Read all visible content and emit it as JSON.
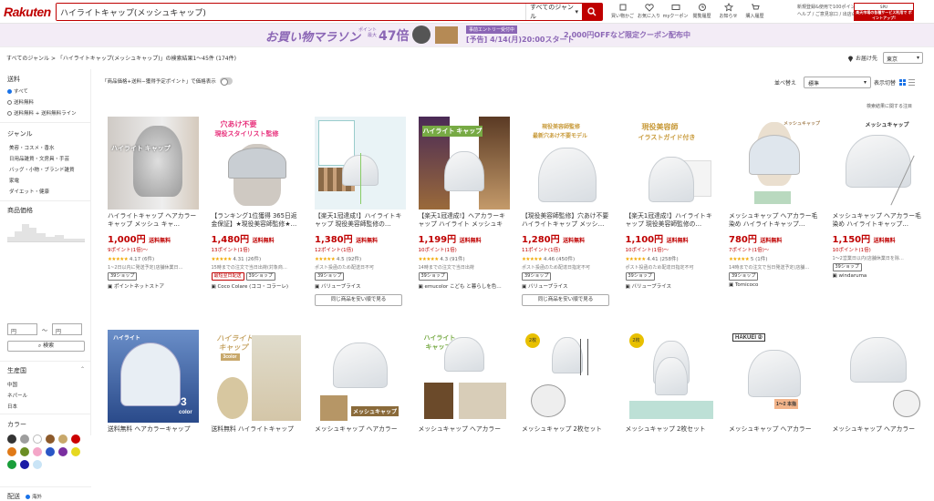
{
  "header": {
    "logo": "Rakuten",
    "search_value": "ハイライトキャップ(メッシュキャップ)",
    "genre": "すべてのジャンル",
    "icons": [
      {
        "name": "purchase-history-icon",
        "label": "買い物かご"
      },
      {
        "name": "favorite-icon",
        "label": "お気に入り"
      },
      {
        "name": "coupon-icon",
        "label": "myクーポン"
      },
      {
        "name": "history-icon",
        "label": "閲覧履歴"
      },
      {
        "name": "notify-icon",
        "label": "お知らせ"
      },
      {
        "name": "cart-icon",
        "label": "購入履歴"
      }
    ],
    "note_line1": "新規登録&使用で100ポイント!",
    "note_line2": "ヘルプ / ご意見窓口 / 出店のご案内",
    "ad_line1": "SPU",
    "ad_line2": "楽天市場の各種サービス利用で ポイントアップ!"
  },
  "banner": {
    "title": "お買い物マラソン",
    "sub1": "ポイント",
    "sub2": "最大",
    "times": "47倍",
    "entry": "事前エントリー受付中",
    "start": "[予告] 4/14(月)20:00スタート",
    "coupon": "2,000円OFFなど限定クーポン配布中"
  },
  "breadcrumb": "すべてのジャンル > 「ハイライトキャップ(メッシュキャップ)」の検索結果1〜45件 (174件)",
  "delivery": {
    "label": "お届け先",
    "value": "東京"
  },
  "sidebar": {
    "shipping_h": "送料",
    "shipping_opts": [
      "すべて",
      "送料無料",
      "送料無料 + 送料無料ライン"
    ],
    "genre_h": "ジャンル",
    "genres": [
      "美容・コスメ・香水",
      "日用品雑貨・文房具・手芸",
      "バッグ・小物・ブランド雑貨",
      "家電",
      "ダイエット・健康"
    ],
    "price_h": "商品価格",
    "price_min": "円",
    "price_tilde": "〜",
    "price_max": "円",
    "search_btn": "検索",
    "origin_h": "生産国",
    "origins": [
      "中国",
      "ネパール",
      "日本"
    ],
    "color_h": "カラー",
    "delivery_h": "配送",
    "delivery_opt": "海外"
  },
  "colors": [
    "#333333",
    "#9e9e9e",
    "#ffffff",
    "#8d5a2b",
    "#c8a86b",
    "#cc0000",
    "#e07a18",
    "#6b8e23",
    "#f4a6c8",
    "#2a56c6",
    "#7a2ea0",
    "#e6d820",
    "#1a9e3a",
    "#1a1aa6",
    "#c9e4f6"
  ],
  "filter": {
    "label": "「商品価格+送料−獲得予定ポイント」で価格表示"
  },
  "sort": {
    "label": "並べ替え",
    "value": "標準"
  },
  "view": {
    "label": "表示切替"
  },
  "feedback": "検索結果に関する注目",
  "products": [
    {
      "title": "ハイライトキャップ ヘアカラーキャップ メッシュ キャ…",
      "price": "1,000円",
      "ship": "送料無料",
      "points": "9ポイント(1倍)〜",
      "rating": "4.17",
      "reviews": "(6件)",
      "note": "1~2日以内に発送予定(店舗休業日…",
      "badge": "39ショップ",
      "shop": "ポイントネットストア",
      "cheap": ""
    },
    {
      "title": "【ランキング1位獲得 365日返金保証】★現役美容師監修★…",
      "price": "1,480円",
      "ship": "送料無料",
      "points": "13ポイント(1倍)",
      "rating": "4.31",
      "reviews": "(26件)",
      "note": "15時までの注文で当日出荷(対象商…",
      "badge": "最短翌日配送",
      "badge2": "39ショップ",
      "shop": "Coco Colare (ココ・コラーレ)",
      "cheap": ""
    },
    {
      "title": "【楽天1冠達成!】ハイライトキャップ 現役美容師監修の…",
      "price": "1,380円",
      "ship": "送料無料",
      "points": "12ポイント(1倍)",
      "rating": "4.5",
      "reviews": "(92件)",
      "note": "ポスト投函のため配送日不可",
      "badge": "39ショップ",
      "shop": "バリュープライス",
      "cheap": "同じ商品を安い順で見る"
    },
    {
      "title": "【楽天1冠達成!】ヘアカラーキャップ ハイライト メッシュキャ…",
      "price": "1,199円",
      "ship": "送料無料",
      "points": "10ポイント(1倍)",
      "rating": "4.3",
      "reviews": "(91件)",
      "note": "14時までの注文で当日出荷",
      "badge": "39ショップ",
      "shop": "emucolor こども と暮らしを色…",
      "cheap": ""
    },
    {
      "title": "【現役美容師監修】穴あけ不要 ハイライトキャップ メッシ…",
      "price": "1,280円",
      "ship": "送料無料",
      "points": "11ポイント(1倍)",
      "rating": "4.46",
      "reviews": "(450件)",
      "note": "ポスト投函のため配達日指定不可",
      "badge": "39ショップ",
      "shop": "バリュープライス",
      "cheap": "同じ商品を安い順で見る"
    },
    {
      "title": "【楽天1冠達成!】ハイライトキャップ 現役美容師監修の…",
      "price": "1,100円",
      "ship": "送料無料",
      "points": "10ポイント(1倍)〜",
      "rating": "4.41",
      "reviews": "(258件)",
      "note": "ポスト投函のため配達日指定不可",
      "badge": "39ショップ",
      "shop": "バリュープライス",
      "cheap": ""
    },
    {
      "title": "メッシュキャップ ヘアカラー毛染め ハイライトキャップ…",
      "price": "780円",
      "ship": "送料無料",
      "points": "7ポイント(1倍)〜",
      "rating": "5",
      "reviews": "(1件)",
      "note": "14時までの注文で当日発送予定(店舗…",
      "badge": "39ショップ",
      "shop": "Tomicoco",
      "cheap": ""
    },
    {
      "title": "メッシュキャップ ヘアカラー毛染め ハイライトキャップ…",
      "price": "1,150円",
      "ship": "送料無料",
      "points": "10ポイント(1倍)",
      "rating": "",
      "reviews": "",
      "note": "1〜2営業日以内(店舗休業日を除…",
      "badge": "39ショップ",
      "shop": "windaruma",
      "cheap": ""
    },
    {
      "title": "送料無料 ヘアカラーキャップ"
    },
    {
      "title": "送料無料 ハイライトキャップ"
    },
    {
      "title": "メッシュキャップ ヘアカラー"
    },
    {
      "title": "メッシュキャップ ヘアカラー"
    },
    {
      "title": "メッシュキャップ 2枚セット"
    },
    {
      "title": "メッシュキャップ 2枚セット"
    },
    {
      "title": "メッシュキャップ ヘアカラー"
    },
    {
      "title": "メッシュキャップ ヘアカラー"
    }
  ],
  "thumb_texts": {
    "p1": "ハイライト キャップ",
    "p2a": "穴あけ不要",
    "p2b": "現役スタイリスト監修",
    "p5a": "現役美容師監修",
    "p5b": "最新穴あけ不要モデル",
    "p6a": "現役美容師",
    "p6b": "イラストガイド付き",
    "p7": "メッシュキャップ",
    "p9": "ハイライト",
    "p9b": "3",
    "p9c": "color",
    "p10a": "ハイライト",
    "p10b": "キャップ",
    "p10c": "3color",
    "p12a": "ハイライト",
    "p12b": "キャップ",
    "p14": "2枚",
    "p15": "HAKUEI ②",
    "p15b": "1〜2 本指"
  }
}
